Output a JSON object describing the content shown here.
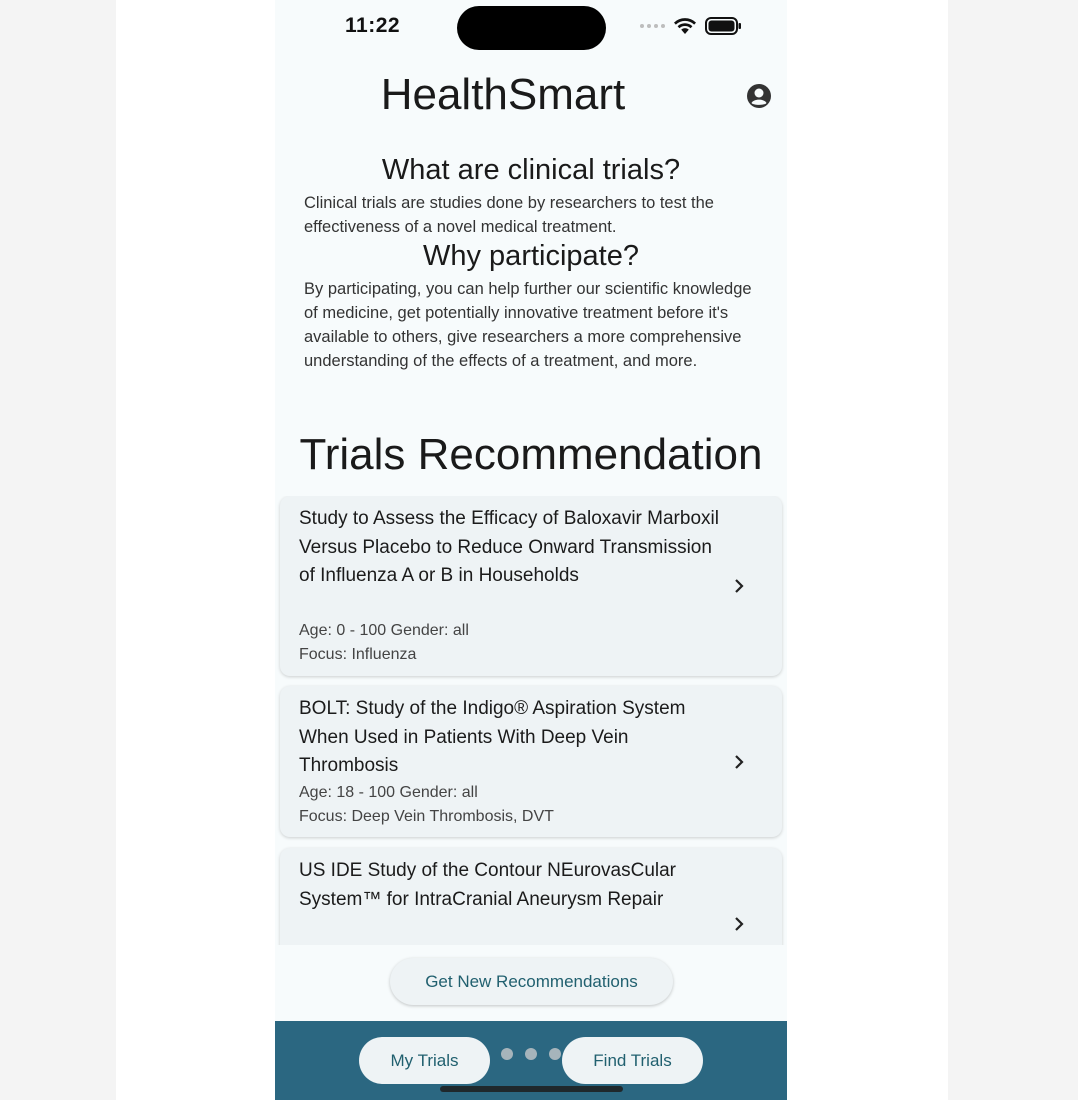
{
  "status_bar": {
    "time": "11:22"
  },
  "header": {
    "title": "HealthSmart"
  },
  "intro": [
    {
      "heading": "What are clinical trials?",
      "text": "Clinical trials are studies done by researchers to test the effectiveness of a novel medical treatment."
    },
    {
      "heading": "Why participate?",
      "text": "By participating, you can help further our scientific knowledge of medicine, get potentially innovative treatment before it's available to others, give researchers a more comprehensive understanding of the effects of a treatment, and more."
    }
  ],
  "recommendations": {
    "title": "Trials Recommendation",
    "trials": [
      {
        "title": "Study to Assess the Efficacy of Baloxavir Marboxil Versus Placebo to Reduce Onward Transmission of Influenza A or B in Households",
        "demographics": "Age: 0 - 100  Gender: all",
        "focus": "Focus: Influenza"
      },
      {
        "title": "BOLT: Study of the Indigo® Aspiration System When Used in Patients With Deep Vein Thrombosis",
        "demographics": "Age: 18 - 100  Gender: all",
        "focus": "Focus: Deep Vein Thrombosis, DVT"
      },
      {
        "title": "US IDE Study of the Contour NEurovasCular System™ for IntraCranial Aneurysm Repair"
      }
    ],
    "get_new_label": "Get New Recommendations"
  },
  "bottom_nav": {
    "my_trials": "My Trials",
    "find_trials": "Find Trials"
  },
  "colors": {
    "accent": "#2b6781",
    "button_text": "#21606f",
    "card_bg": "#eef3f5",
    "page_bg": "#f7fbfc"
  },
  "icons": {
    "profile": "account-circle-icon",
    "chevron": "chevron-right-icon",
    "wifi": "wifi-icon",
    "battery": "battery-icon"
  }
}
